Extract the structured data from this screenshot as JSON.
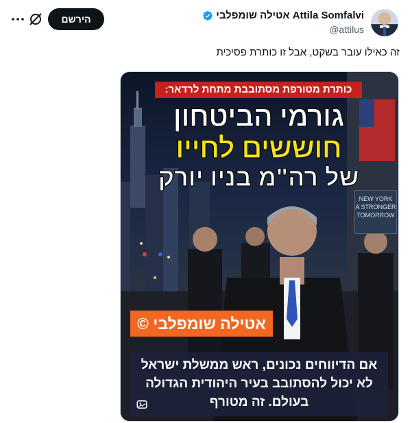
{
  "author": {
    "display_name": "אטילה שומפלבי Attila Somfalvi",
    "handle": "@attilus",
    "verified": true
  },
  "actions": {
    "follow_label": "הירשם",
    "grok_icon": "grok-icon",
    "more_icon": "more-icon"
  },
  "tweet": {
    "text": "זה כאילו עובר בשקט, אבל זו כותרת פסיכית"
  },
  "media": {
    "banner_red": "כותרת מטורפת מסתובבת מתחת לרדאר:",
    "headline_line1": "גורמי הביטחון",
    "headline_line2": "חוששים לחייו",
    "headline_line3": "של רה\"מ בניו יורק",
    "sign_lines": [
      "NEW YORK",
      "A STRONGER",
      "TOMORROW"
    ],
    "orange_tag": "אטילה שומפלבי ©",
    "caption_line1": "אם הדיווחים נכונים, ראש ממשלת ישראל",
    "caption_line2": "לא יכול להסתובב בעיר היהודית הגדולה",
    "caption_line3": "בעולם. זה מטורף",
    "colors": {
      "banner": "#c8201d",
      "headline_yellow": "#f8e11a",
      "tag_orange": "#f26722"
    }
  }
}
